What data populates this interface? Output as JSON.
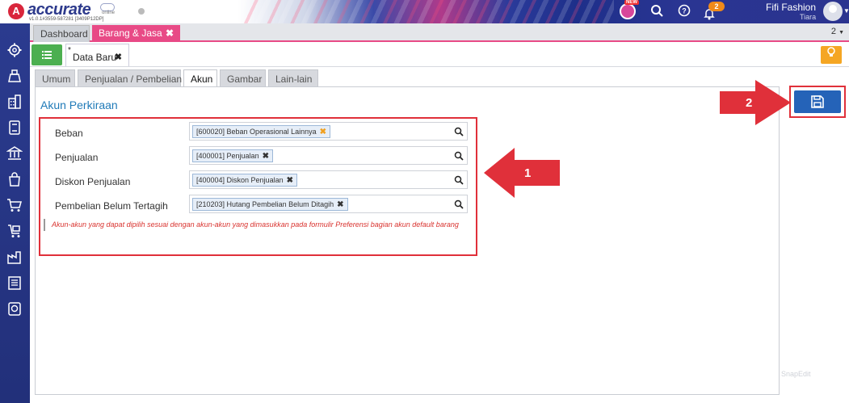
{
  "app": {
    "logo_mark": "A",
    "logo_text": "accurate",
    "logo_online": "online",
    "version": "v1.0.1#3559-587281 [3409P12DP]"
  },
  "topbar": {
    "new_badge": "NEW",
    "notification_count": "2",
    "user_name": "Fifi Fashion",
    "user_sub": "Tiara"
  },
  "module_tabs": {
    "dashboard": "Dashboard",
    "barang_jasa": "Barang & Jasa",
    "close": "✖",
    "tab_count": "2"
  },
  "doc_tab": {
    "star": "*",
    "label": "Data Baru",
    "close": "✖"
  },
  "form_tabs": [
    {
      "label": "Umum"
    },
    {
      "label": "Penjualan / Pembelian"
    },
    {
      "label": "Akun"
    },
    {
      "label": "Gambar"
    },
    {
      "label": "Lain-lain"
    }
  ],
  "section": {
    "title": "Akun Perkiraan"
  },
  "rows": [
    {
      "label": "Beban",
      "chip": "[600020] Beban Operasional Lainnya",
      "remove": "✖"
    },
    {
      "label": "Penjualan",
      "chip": "[400001] Penjualan",
      "remove": "✖"
    },
    {
      "label": "Diskon Penjualan",
      "chip": "[400004] Diskon Penjualan",
      "remove": "✖"
    },
    {
      "label": "Pembelian Belum Tertagih",
      "chip": "[210203] Hutang Pembelian Belum Ditagih",
      "remove": "✖"
    }
  ],
  "note": "Akun-akun yang dapat dipilih sesuai dengan akun-akun yang dimasukkan pada formulir Preferensi bagian akun default barang",
  "annotations": {
    "arrow1_label": "1",
    "arrow2_label": "2"
  },
  "watermark": "SnapEdit",
  "colors": {
    "accent_pink": "#e84a86",
    "primary_blue": "#2563b8",
    "annotation_red": "#e0303a",
    "sidebar_blue": "#2b3b8f",
    "section_title_blue": "#1f7ab8"
  },
  "sidebar_icons": [
    "settings-icon",
    "inventory-icon",
    "building-icon",
    "book-icon",
    "bank-icon",
    "sales-bag-icon",
    "cart-icon",
    "purchase-cart-icon",
    "factory-icon",
    "report-icon",
    "finance-icon"
  ]
}
